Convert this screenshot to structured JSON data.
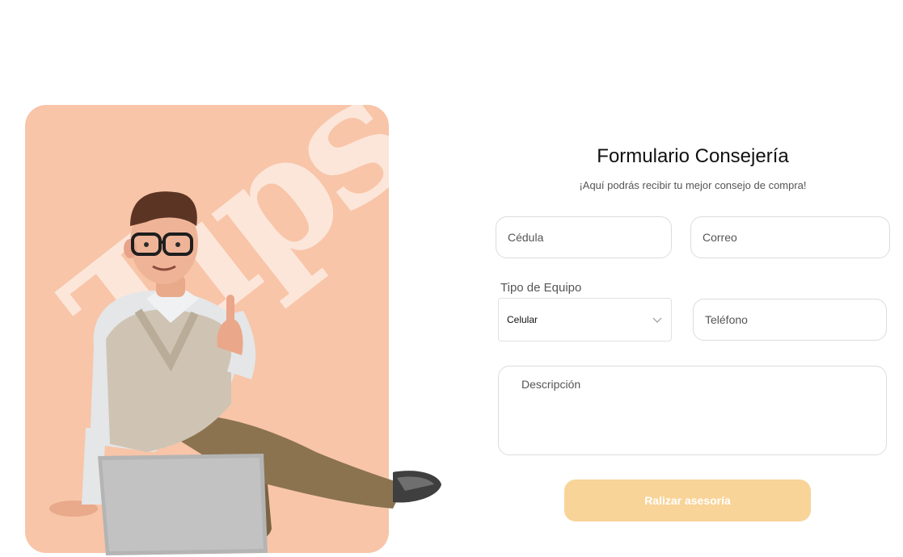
{
  "hero": {
    "tips_text": "Tips",
    "background_color": "#f8c5a8",
    "tips_color": "#fce6da"
  },
  "form": {
    "title": "Formulario Consejería",
    "subtitle": "¡Aquí podrás recibir tu mejor consejo de compra!",
    "cedula_placeholder": "Cédula",
    "correo_placeholder": "Correo",
    "tipo_label": "Tipo de Equipo",
    "tipo_selected": "Celular",
    "telefono_placeholder": "Teléfono",
    "descripcion_placeholder": "Descripción",
    "submit_label": "Ralizar asesoría",
    "submit_color": "#f8d498"
  }
}
